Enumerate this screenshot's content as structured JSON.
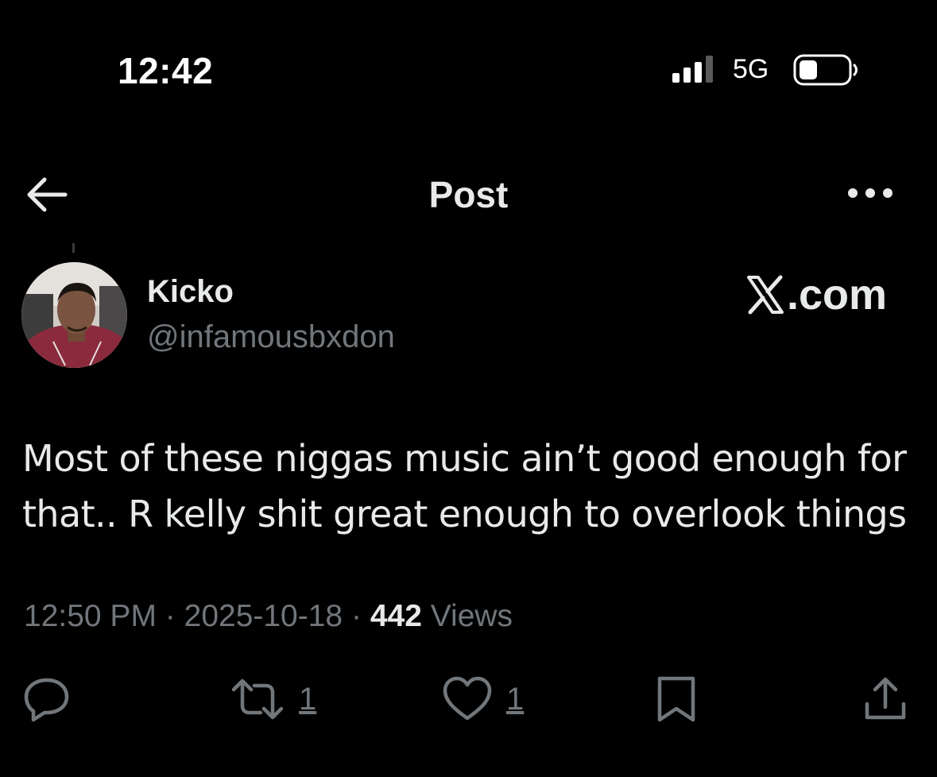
{
  "status_bar": {
    "time": "12:42",
    "network": "5G"
  },
  "header": {
    "title": "Post",
    "back_icon": "arrow-left-icon",
    "more_icon": "more-horizontal-icon"
  },
  "author": {
    "name": "Kicko",
    "handle": "@infamousbxdon",
    "brand": ".com"
  },
  "post": {
    "text": "Most of these niggas music ain’t good enough for\nthat.. R kelly shit great enough to overlook things",
    "time": "12:50 PM",
    "date": "2025-10-18",
    "separator": "·",
    "views_count": "442",
    "views_label": "Views"
  },
  "actions": {
    "reply_icon": "reply-icon",
    "repost_icon": "repost-icon",
    "repost_count": "1",
    "like_icon": "heart-icon",
    "like_count": "1",
    "bookmark_icon": "bookmark-icon",
    "share_icon": "share-icon"
  },
  "colors": {
    "background": "#000000",
    "text_primary": "#e7e9ea",
    "text_secondary": "#71767b"
  }
}
